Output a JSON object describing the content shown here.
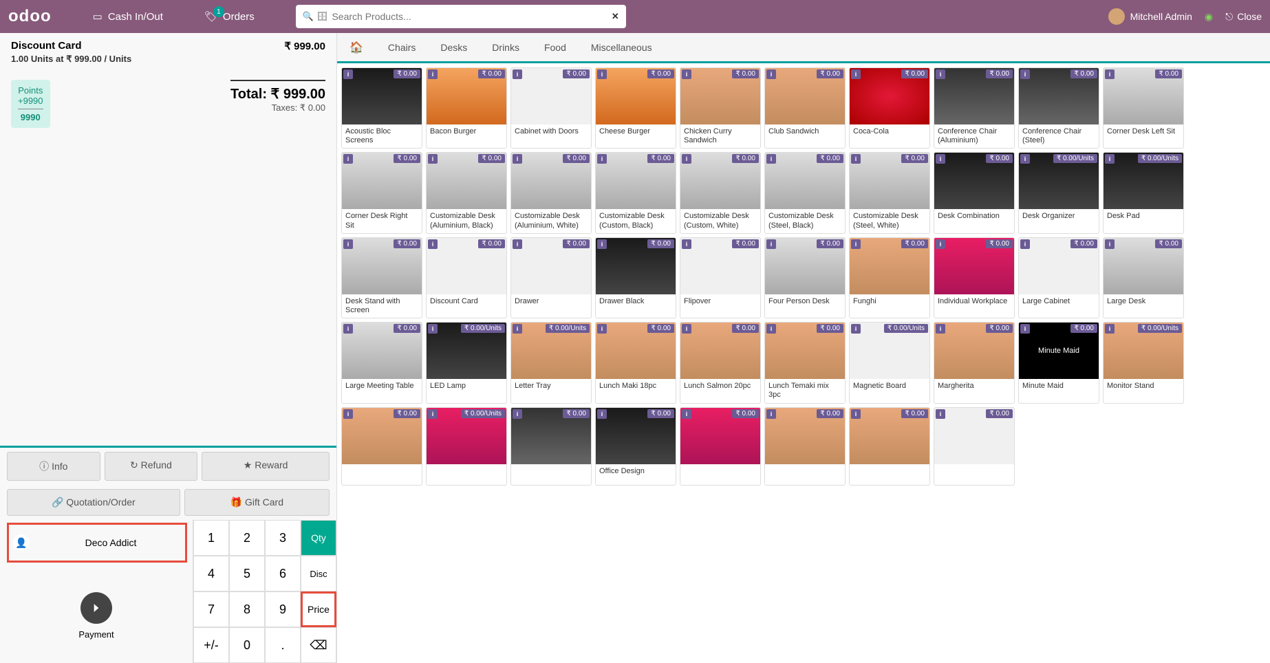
{
  "header": {
    "brand": "odoo",
    "cash_btn": "Cash In/Out",
    "orders_btn": "Orders",
    "orders_count": "1",
    "search_placeholder": "Search Products...",
    "user": "Mitchell Admin",
    "close": "Close"
  },
  "order": {
    "product": "Discount Card",
    "price": "₹ 999.00",
    "qty_line": "1.00 Units at ₹ 999.00 / Units",
    "points_label": "Points",
    "points_delta": "+9990",
    "points_total": "9990",
    "total_label": "Total: ₹ 999.00",
    "taxes": "Taxes: ₹ 0.00"
  },
  "actions": {
    "info": "Info",
    "refund": "Refund",
    "reward": "Reward",
    "quotation": "Quotation/Order",
    "giftcard": "Gift Card",
    "customer": "Deco Addict",
    "payment": "Payment"
  },
  "keypad": {
    "k1": "1",
    "k2": "2",
    "k3": "3",
    "qty": "Qty",
    "k4": "4",
    "k5": "5",
    "k6": "6",
    "disc": "Disc",
    "k7": "7",
    "k8": "8",
    "k9": "9",
    "price": "Price",
    "pm": "+/-",
    "k0": "0",
    "dot": ".",
    "del": "⌫"
  },
  "categories": [
    "Chairs",
    "Desks",
    "Drinks",
    "Food",
    "Miscellaneous"
  ],
  "products": [
    {
      "name": "Acoustic Bloc Screens",
      "price": "₹ 0.00",
      "img": "img-black"
    },
    {
      "name": "Bacon Burger",
      "price": "₹ 0.00",
      "img": "img-burger"
    },
    {
      "name": "Cabinet with Doors",
      "price": "₹ 0.00",
      "img": "img-White"
    },
    {
      "name": "Cheese Burger",
      "price": "₹ 0.00",
      "img": "img-burger"
    },
    {
      "name": "Chicken Curry Sandwich",
      "price": "₹ 0.00",
      "img": "img-food"
    },
    {
      "name": "Club Sandwich",
      "price": "₹ 0.00",
      "img": "img-food"
    },
    {
      "name": "Coca-Cola",
      "price": "₹ 0.00",
      "img": "img-coke"
    },
    {
      "name": "Conference Chair (Aluminium)",
      "price": "₹ 0.00",
      "img": "img-chair"
    },
    {
      "name": "Conference Chair (Steel)",
      "price": "₹ 0.00",
      "img": "img-chair"
    },
    {
      "name": "Corner Desk Left Sit",
      "price": "₹ 0.00",
      "img": "img-desk"
    },
    {
      "name": "Corner Desk Right Sit",
      "price": "₹ 0.00",
      "img": "img-desk"
    },
    {
      "name": "Customizable Desk (Aluminium, Black)",
      "price": "₹ 0.00",
      "img": "img-desk"
    },
    {
      "name": "Customizable Desk (Aluminium, White)",
      "price": "₹ 0.00",
      "img": "img-desk"
    },
    {
      "name": "Customizable Desk (Custom, Black)",
      "price": "₹ 0.00",
      "img": "img-desk"
    },
    {
      "name": "Customizable Desk (Custom, White)",
      "price": "₹ 0.00",
      "img": "img-desk"
    },
    {
      "name": "Customizable Desk (Steel, Black)",
      "price": "₹ 0.00",
      "img": "img-desk"
    },
    {
      "name": "Customizable Desk (Steel, White)",
      "price": "₹ 0.00",
      "img": "img-desk"
    },
    {
      "name": "Desk Combination",
      "price": "₹ 0.00",
      "img": "img-black"
    },
    {
      "name": "Desk Organizer",
      "price": "₹ 0.00/Units",
      "img": "img-black"
    },
    {
      "name": "Desk Pad",
      "price": "₹ 0.00/Units",
      "img": "img-black"
    },
    {
      "name": "Desk Stand with Screen",
      "price": "₹ 0.00",
      "img": "img-desk"
    },
    {
      "name": "Discount Card",
      "price": "₹ 0.00",
      "img": "img-White"
    },
    {
      "name": "Drawer",
      "price": "₹ 0.00",
      "img": "img-White"
    },
    {
      "name": "Drawer Black",
      "price": "₹ 0.00",
      "img": "img-black"
    },
    {
      "name": "Flipover",
      "price": "₹ 0.00",
      "img": "img-White"
    },
    {
      "name": "Four Person Desk",
      "price": "₹ 0.00",
      "img": "img-desk"
    },
    {
      "name": "Funghi",
      "price": "₹ 0.00",
      "img": "img-food"
    },
    {
      "name": "Individual Workplace",
      "price": "₹ 0.00",
      "img": "img-pink"
    },
    {
      "name": "Large Cabinet",
      "price": "₹ 0.00",
      "img": "img-White"
    },
    {
      "name": "Large Desk",
      "price": "₹ 0.00",
      "img": "img-desk"
    },
    {
      "name": "Large Meeting Table",
      "price": "₹ 0.00",
      "img": "img-desk"
    },
    {
      "name": "LED Lamp",
      "price": "₹ 0.00/Units",
      "img": "img-black"
    },
    {
      "name": "Letter Tray",
      "price": "₹ 0.00/Units",
      "img": "img-food"
    },
    {
      "name": "Lunch Maki 18pc",
      "price": "₹ 0.00",
      "img": "img-food"
    },
    {
      "name": "Lunch Salmon 20pc",
      "price": "₹ 0.00",
      "img": "img-food"
    },
    {
      "name": "Lunch Temaki mix 3pc",
      "price": "₹ 0.00",
      "img": "img-food"
    },
    {
      "name": "Magnetic Board",
      "price": "₹ 0.00/Units",
      "img": "img-White"
    },
    {
      "name": "Margherita",
      "price": "₹ 0.00",
      "img": "img-food"
    },
    {
      "name": "Minute Maid",
      "price": "₹ 0.00",
      "img": "img-mmaid"
    },
    {
      "name": "Monitor Stand",
      "price": "₹ 0.00/Units",
      "img": "img-food"
    },
    {
      "name": "",
      "price": "₹ 0.00",
      "img": "img-food"
    },
    {
      "name": "",
      "price": "₹ 0.00/Units",
      "img": "img-pink"
    },
    {
      "name": "",
      "price": "₹ 0.00",
      "img": "img-chair"
    },
    {
      "name": "Office Design",
      "price": "₹ 0.00",
      "img": "img-black"
    },
    {
      "name": "",
      "price": "₹ 0.00",
      "img": "img-pink"
    },
    {
      "name": "",
      "price": "₹ 0.00",
      "img": "img-food"
    },
    {
      "name": "",
      "price": "₹ 0.00",
      "img": "img-food"
    },
    {
      "name": "",
      "price": "₹ 0.00",
      "img": "img-White"
    }
  ]
}
